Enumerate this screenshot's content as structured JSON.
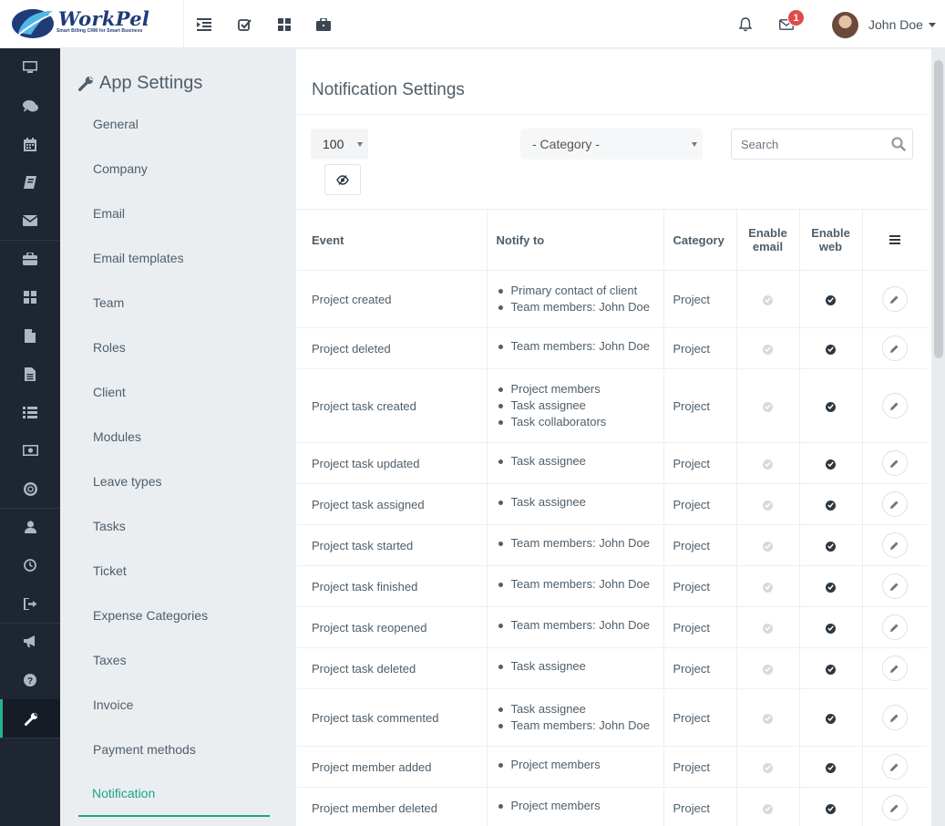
{
  "brand": {
    "name": "WorkPel",
    "tagline": "Smart Billing CRM for Smart Business"
  },
  "topbar": {
    "icons": [
      "sidebar-toggle-icon",
      "todo-icon",
      "dashboard-grid-icon",
      "projects-briefcase-icon"
    ],
    "notifications_icon": "bell-icon",
    "messages_icon": "envelope-icon",
    "messages_count": "1",
    "user_name": "John Doe"
  },
  "rail": {
    "items": [
      "dashboard-icon",
      "messages-icon",
      "events-calendar-icon",
      "notes-book-icon",
      "email-icon",
      "projects-icon",
      "widgets-grid-icon",
      "invoices-file-icon",
      "estimates-file-icon",
      "tasks-list-icon",
      "expenses-money-icon",
      "tickets-lifebuoy-icon",
      "team-user-icon",
      "timecards-clock-icon",
      "leaves-signout-icon",
      "announcements-megaphone-icon",
      "help-question-icon",
      "settings-wrench-icon"
    ],
    "active": "settings-wrench-icon"
  },
  "settings_menu": {
    "title": "App Settings",
    "items": [
      "General",
      "Company",
      "Email",
      "Email templates",
      "Team",
      "Roles",
      "Client",
      "Modules",
      "Leave types",
      "Tasks",
      "Ticket",
      "Expense Categories",
      "Taxes",
      "Invoice",
      "Payment methods",
      "Notification"
    ],
    "active": "Notification"
  },
  "panel": {
    "title": "Notification Settings",
    "page_length": "100",
    "category_filter": "- Category -",
    "search_placeholder": "Search",
    "columns": {
      "event": "Event",
      "notify_to": "Notify to",
      "category": "Category",
      "enable_email": "Enable email",
      "enable_web": "Enable web"
    }
  },
  "rows": [
    {
      "event": "Project created",
      "notify": [
        "Primary contact of client",
        "Team members: John Doe"
      ],
      "category": "Project",
      "email": false,
      "web": true
    },
    {
      "event": "Project deleted",
      "notify": [
        "Team members: John Doe"
      ],
      "category": "Project",
      "email": false,
      "web": true
    },
    {
      "event": "Project task created",
      "notify": [
        "Project members",
        "Task assignee",
        "Task collaborators"
      ],
      "category": "Project",
      "email": false,
      "web": true
    },
    {
      "event": "Project task updated",
      "notify": [
        "Task assignee"
      ],
      "category": "Project",
      "email": false,
      "web": true
    },
    {
      "event": "Project task assigned",
      "notify": [
        "Task assignee"
      ],
      "category": "Project",
      "email": false,
      "web": true
    },
    {
      "event": "Project task started",
      "notify": [
        "Team members: John Doe"
      ],
      "category": "Project",
      "email": false,
      "web": true
    },
    {
      "event": "Project task finished",
      "notify": [
        "Team members: John Doe"
      ],
      "category": "Project",
      "email": false,
      "web": true
    },
    {
      "event": "Project task reopened",
      "notify": [
        "Team members: John Doe"
      ],
      "category": "Project",
      "email": false,
      "web": true
    },
    {
      "event": "Project task deleted",
      "notify": [
        "Task assignee"
      ],
      "category": "Project",
      "email": false,
      "web": true
    },
    {
      "event": "Project task commented",
      "notify": [
        "Task assignee",
        "Team members: John Doe"
      ],
      "category": "Project",
      "email": false,
      "web": true
    },
    {
      "event": "Project member added",
      "notify": [
        "Project members"
      ],
      "category": "Project",
      "email": false,
      "web": true
    },
    {
      "event": "Project member deleted",
      "notify": [
        "Project members"
      ],
      "category": "Project",
      "email": false,
      "web": true
    }
  ],
  "colors": {
    "rail_bg": "#1d2632",
    "accent": "#1aa38a",
    "badge": "#e04b4b"
  }
}
